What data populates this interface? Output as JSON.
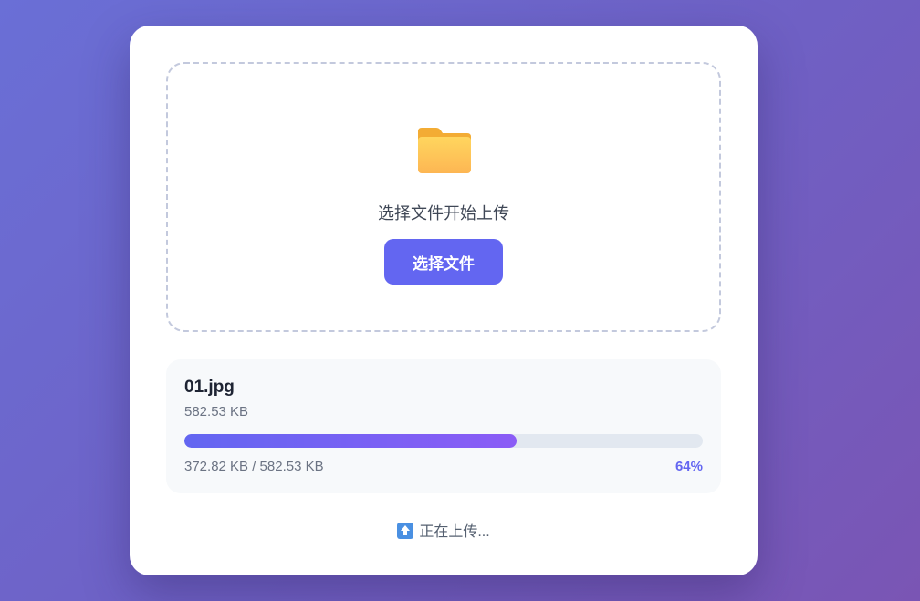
{
  "dropzone": {
    "icon": "folder-icon",
    "text": "选择文件开始上传",
    "button_label": "选择文件"
  },
  "file": {
    "name": "01.jpg",
    "size": "582.53 KB",
    "progress_text": "372.82 KB / 582.53 KB",
    "percent_label": "64%",
    "progress_fraction": 0.64
  },
  "status": {
    "icon": "up-arrow-icon",
    "text": "正在上传..."
  },
  "colors": {
    "accent": "#6366f1",
    "accent_end": "#8b5cf6",
    "folder": "#fcc54e"
  }
}
